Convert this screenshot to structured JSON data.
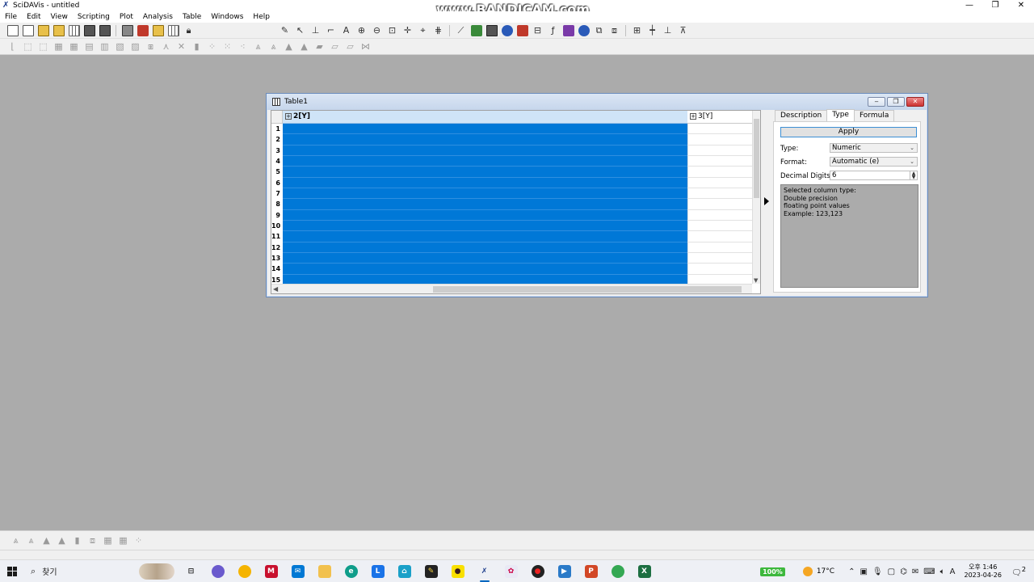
{
  "window": {
    "title": "SciDAVis - untitled",
    "watermark": "www.BANDICAM.com",
    "minimize": "—",
    "maximize": "❐",
    "close": "✕"
  },
  "menu": [
    "File",
    "Edit",
    "View",
    "Scripting",
    "Plot",
    "Analysis",
    "Table",
    "Windows",
    "Help"
  ],
  "table_window": {
    "title": "Table1",
    "columns": [
      {
        "label": "2[Y]",
        "selected": true
      },
      {
        "label": "3[Y]",
        "selected": false
      }
    ],
    "rows": [
      "1",
      "2",
      "3",
      "4",
      "5",
      "6",
      "7",
      "8",
      "9",
      "10",
      "11",
      "12",
      "13",
      "14",
      "15"
    ]
  },
  "properties": {
    "tabs": [
      "Description",
      "Type",
      "Formula"
    ],
    "active_tab": "Type",
    "apply_label": "Apply",
    "type_label": "Type:",
    "type_value": "Numeric",
    "format_label": "Format:",
    "format_value": "Automatic (e)",
    "digits_label": "Decimal Digits:",
    "digits_value": "6",
    "info_lines": [
      "Selected column type:",
      "Double precision",
      "floating point values",
      "Example: 123,123"
    ]
  },
  "taskbar": {
    "search_placeholder": "찾기",
    "battery": "100%",
    "temperature": "17°C",
    "time_ampm": "오후 1:46",
    "date": "2023-04-26",
    "notification_count": "2"
  }
}
